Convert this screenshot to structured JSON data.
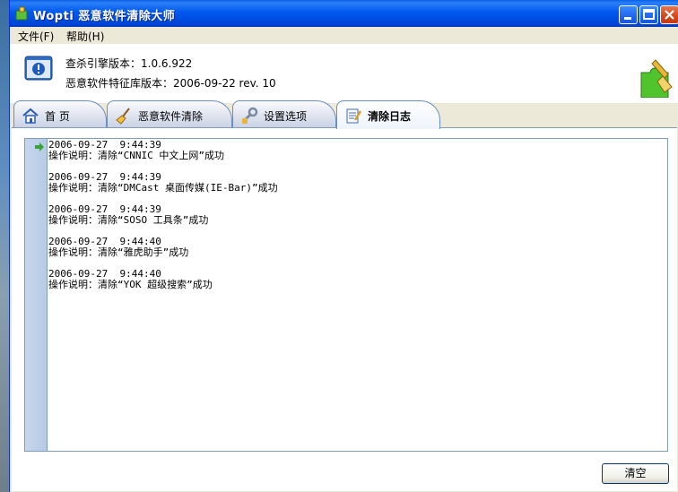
{
  "window": {
    "title": "Wopti 恶意软件清除大师"
  },
  "menu": {
    "items": [
      "文件(F)",
      "帮助(H)"
    ]
  },
  "header": {
    "engine_version": "查杀引擎版本：1.0.6.922",
    "signature_version": "恶意软件特征库版本：2006-09-22 rev. 10"
  },
  "tabs": [
    {
      "label": "首  页",
      "icon": "home-icon",
      "active": false
    },
    {
      "label": "恶意软件清除",
      "icon": "broom-icon",
      "active": false
    },
    {
      "label": "设置选项",
      "icon": "wrench-icon",
      "active": false
    },
    {
      "label": "清除日志",
      "icon": "notepad-icon",
      "active": true
    }
  ],
  "log": {
    "entries": [
      {
        "time": "2006-09-27  9:44:39",
        "desc": "操作说明：清除“CNNIC 中文上网”成功"
      },
      {
        "time": "2006-09-27  9:44:39",
        "desc": "操作说明：清除“DMCast 桌面传媒(IE-Bar)”成功"
      },
      {
        "time": "2006-09-27  9:44:39",
        "desc": "操作说明：清除“SOSO 工具条”成功"
      },
      {
        "time": "2006-09-27  9:44:40",
        "desc": "操作说明：清除“雅虎助手”成功"
      },
      {
        "time": "2006-09-27  9:44:40",
        "desc": "操作说明：清除“YOK 超级搜索”成功"
      }
    ]
  },
  "buttons": {
    "clear_label": "清空"
  },
  "colors": {
    "titlebar": "#0058ee",
    "gutter": "#c6d6ec",
    "arrow": "#3aa23a"
  }
}
